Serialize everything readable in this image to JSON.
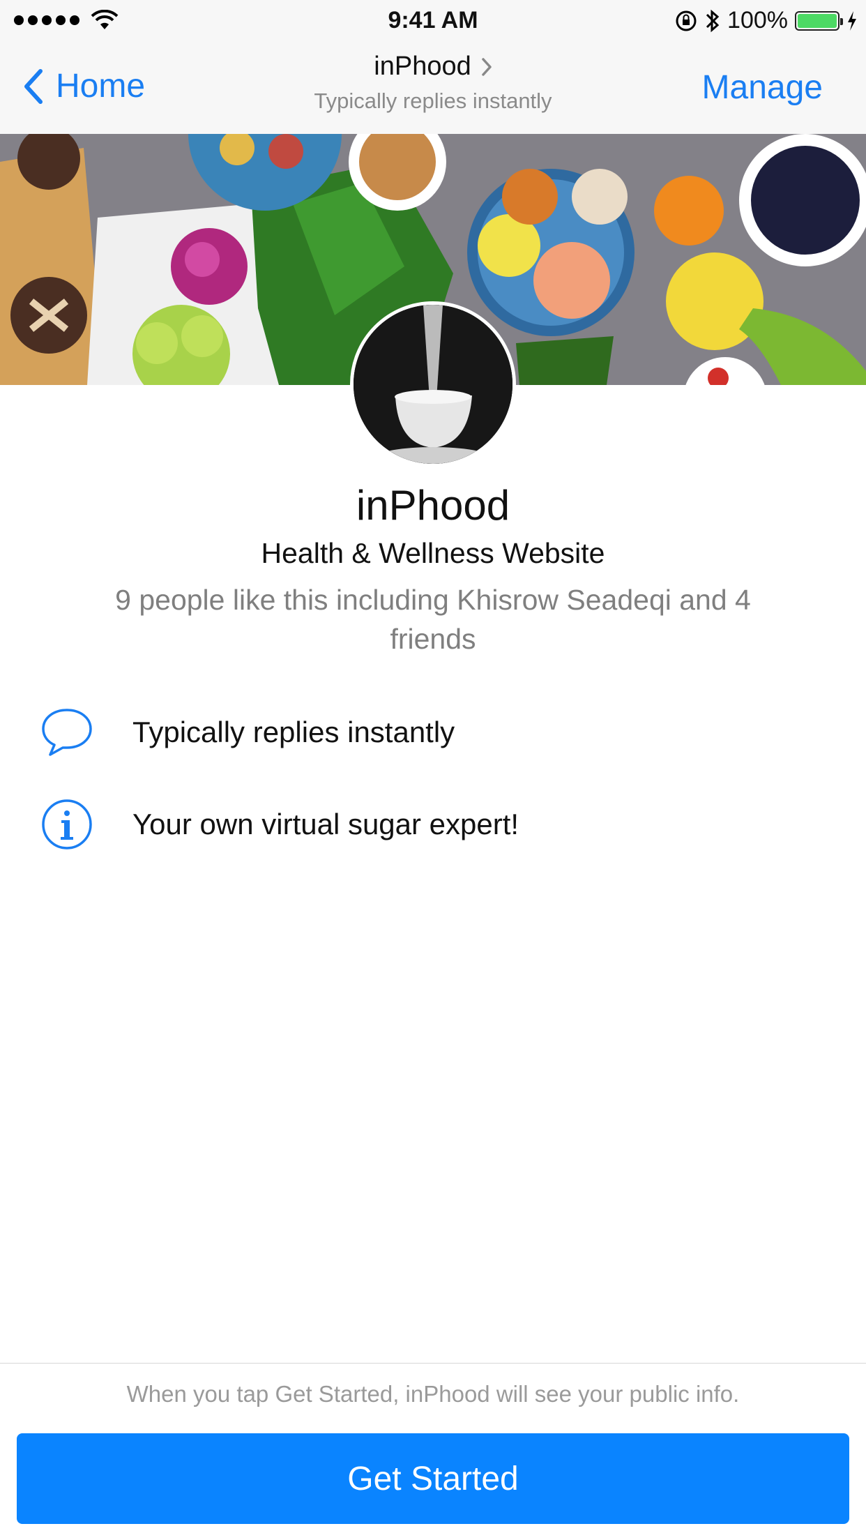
{
  "status": {
    "time": "9:41 AM",
    "battery": "100%"
  },
  "nav": {
    "back_label": "Home",
    "title": "inPhood",
    "subtitle": "Typically replies instantly",
    "action_label": "Manage"
  },
  "profile": {
    "name": "inPhood",
    "category": "Health & Wellness Website",
    "likes_text": "9 people like this including Khisrow Seadeqi and 4 friends"
  },
  "info": {
    "response": "Typically replies instantly",
    "about": "Your own virtual sugar expert!"
  },
  "footer": {
    "disclaimer": "When you tap Get Started, inPhood will see your public info.",
    "cta_label": "Get Started"
  },
  "colors": {
    "accent": "#1a7ef2",
    "button": "#0a84ff",
    "battery": "#4cd964"
  }
}
